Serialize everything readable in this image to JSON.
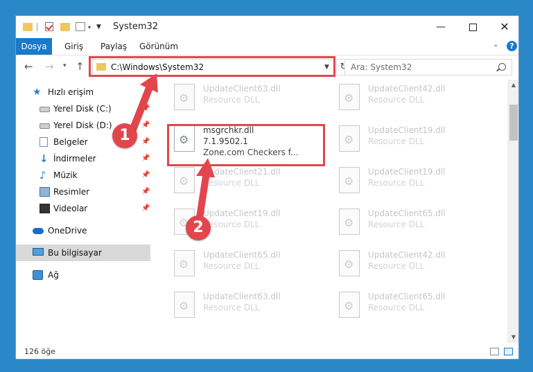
{
  "window": {
    "title": "System32",
    "controls": {
      "minimize": "—",
      "maximize": "",
      "close": "✕"
    }
  },
  "ribbon": {
    "tabs": [
      "Dosya",
      "Giriş",
      "Paylaş",
      "Görünüm"
    ],
    "help": "?"
  },
  "nav": {
    "address": "C:\\Windows\\System32",
    "search_placeholder": "Ara: System32"
  },
  "sidebar": {
    "items": [
      {
        "label": "Hızlı erişim",
        "icon": "star-icon"
      },
      {
        "label": "Yerel Disk (C:)",
        "icon": "drive-icon",
        "pinned": true
      },
      {
        "label": "Yerel Disk (D:)",
        "icon": "drive-icon",
        "pinned": true
      },
      {
        "label": "Belgeler",
        "icon": "document-icon",
        "pinned": true
      },
      {
        "label": "İndirmeler",
        "icon": "download-icon",
        "pinned": true
      },
      {
        "label": "Müzik",
        "icon": "music-icon",
        "pinned": true
      },
      {
        "label": "Resimler",
        "icon": "pictures-icon",
        "pinned": true
      },
      {
        "label": "Videolar",
        "icon": "video-icon",
        "pinned": true
      },
      {
        "label": "OneDrive",
        "icon": "cloud-icon"
      },
      {
        "label": "Bu bilgisayar",
        "icon": "computer-icon",
        "selected": true
      },
      {
        "label": "Ağ",
        "icon": "network-icon"
      }
    ]
  },
  "files": [
    {
      "name": "UpdateClient63.dll",
      "desc": "Resource DLL"
    },
    {
      "name": "UpdateClient42.dll",
      "desc": "Resource DLL"
    },
    {
      "name": "msgrchkr.dll",
      "version": "7.1.9502.1",
      "desc": "Zone.com Checkers f...",
      "focused": true
    },
    {
      "name": "UpdateClient19.dll",
      "desc": "Resource DLL"
    },
    {
      "name": "UpdateClient21.dll",
      "desc": "Resource DLL"
    },
    {
      "name": "UpdateClient19.dll",
      "desc": "Resource DLL"
    },
    {
      "name": "UpdateClient19.dll",
      "desc": "Resource DLL"
    },
    {
      "name": "UpdateClient65.dll",
      "desc": "Resource DLL"
    },
    {
      "name": "UpdateClient65.dll",
      "desc": "Resource DLL"
    },
    {
      "name": "UpdateClient42.dll",
      "desc": "Resource DLL"
    },
    {
      "name": "UpdateClient63.dll",
      "desc": "Resource DLL"
    },
    {
      "name": "UpdateClient65.dll",
      "desc": "Resource DLL"
    }
  ],
  "status": {
    "count": "126 öğe"
  },
  "annotations": {
    "badge1": "1",
    "badge2": "2",
    "color": "#e2464c"
  },
  "colors": {
    "accent": "#1979ca",
    "desktop": "#2a88c8"
  }
}
